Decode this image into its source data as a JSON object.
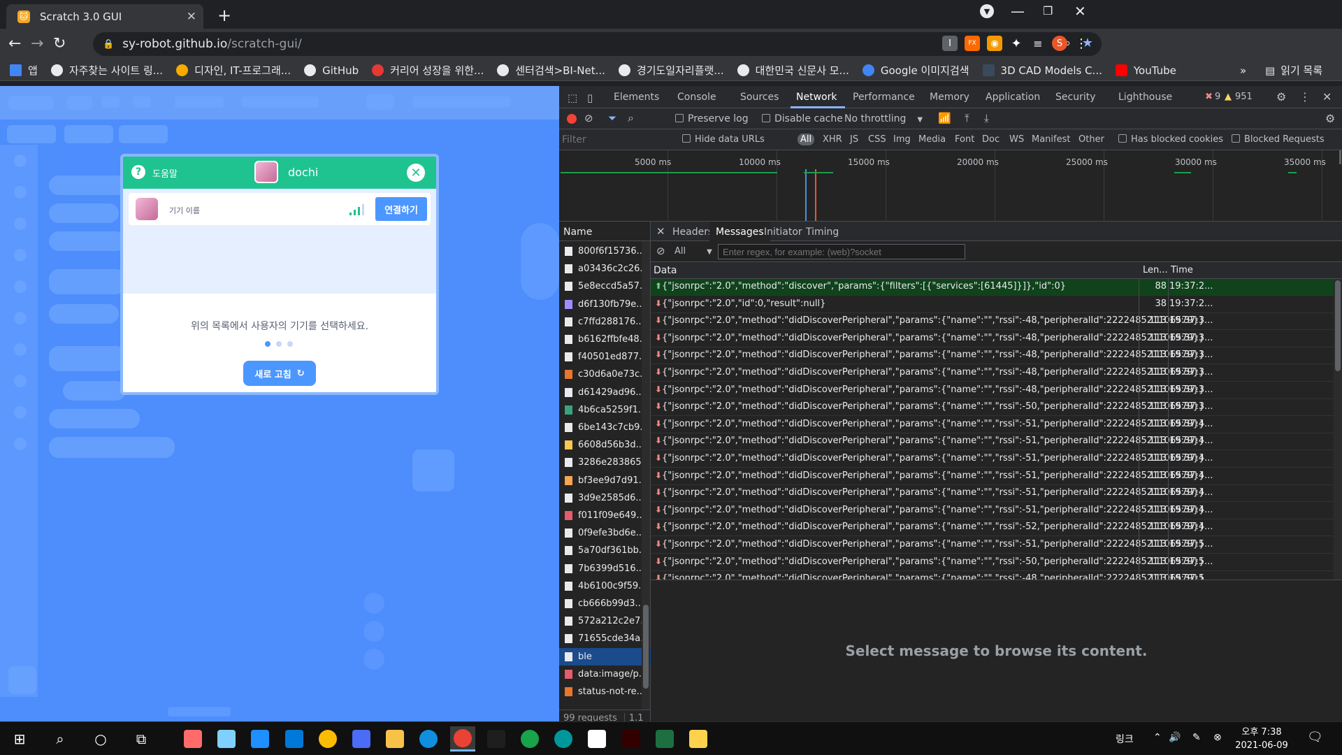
{
  "browser": {
    "tab_title": "Scratch 3.0 GUI",
    "url_host": "sy-robot.github.io",
    "url_path": "/scratch-gui/",
    "profile_initial": "S"
  },
  "bookmarks": [
    {
      "label": "앱",
      "color": "#4285f4"
    },
    {
      "label": "자주찾는 사이트 링...",
      "color": "#e8eaed"
    },
    {
      "label": "디자인, IT-프로그래...",
      "color": "#f9ab00"
    },
    {
      "label": "GitHub",
      "color": "#e8eaed"
    },
    {
      "label": "커리어 성장을 위한...",
      "color": "#e53935"
    },
    {
      "label": "센터검색>BI-Net...",
      "color": "#e8eaed"
    },
    {
      "label": "경기도일자리플랫...",
      "color": "#e8eaed"
    },
    {
      "label": "대한민국 신문사 모...",
      "color": "#e8eaed"
    },
    {
      "label": "Google 이미지검색",
      "color": "#4285f4"
    },
    {
      "label": "3D CAD Models C...",
      "color": "#3a4a5c"
    },
    {
      "label": "YouTube",
      "color": "#ff0000"
    }
  ],
  "bookmarks_more": "»",
  "reading_list": "읽기 목록",
  "modal": {
    "help_label": "도움말",
    "device_title": "dochi",
    "device_name": "기기 이름",
    "connect_label": "연결하기",
    "instruction": "위의 목록에서 사용자의 기기를 선택하세요.",
    "refresh_label": "새로 고침"
  },
  "devtools": {
    "tabs": [
      "Elements",
      "Console",
      "Sources",
      "Network",
      "Performance",
      "Memory",
      "Application",
      "Security",
      "Lighthouse"
    ],
    "active_tab": "Network",
    "error_count": "9",
    "warning_count": "951",
    "preserve_log": "Preserve log",
    "disable_cache": "Disable cache",
    "throttling": "No throttling",
    "filter_placeholder": "Filter",
    "hide_data_urls": "Hide data URLs",
    "type_filters": [
      "All",
      "XHR",
      "JS",
      "CSS",
      "Img",
      "Media",
      "Font",
      "Doc",
      "WS",
      "Manifest",
      "Other"
    ],
    "has_blocked_cookies": "Has blocked cookies",
    "blocked_requests": "Blocked Requests",
    "timeline_labels": [
      "5000 ms",
      "10000 ms",
      "15000 ms",
      "20000 ms",
      "25000 ms",
      "30000 ms",
      "35000 ms"
    ],
    "name_header": "Name",
    "requests": [
      {
        "name": "800f6f15736...",
        "color": "#e8eaed"
      },
      {
        "name": "a03436c2c26...",
        "color": "#e8eaed"
      },
      {
        "name": "5e8eccd5a57...",
        "color": "#e8eaed"
      },
      {
        "name": "d6f130fb79e...",
        "color": "#a08cff"
      },
      {
        "name": "c7ffd288176...",
        "color": "#e8eaed"
      },
      {
        "name": "b6162ffbfe48...",
        "color": "#e8eaed"
      },
      {
        "name": "f40501ed877...",
        "color": "#e8eaed"
      },
      {
        "name": "c30d6a0e73c...",
        "color": "#e8762b"
      },
      {
        "name": "d61429ad96...",
        "color": "#e8eaed"
      },
      {
        "name": "4b6ca5259f1...",
        "color": "#3aa17e"
      },
      {
        "name": "6be143c7cb9...",
        "color": "#e8eaed"
      },
      {
        "name": "6608d56b3d...",
        "color": "#f9c74f"
      },
      {
        "name": "3286e283865...",
        "color": "#e8eaed"
      },
      {
        "name": "bf3ee9d7d91...",
        "color": "#f9a64f"
      },
      {
        "name": "3d9e2585d6...",
        "color": "#e8eaed"
      },
      {
        "name": "f011f09e649...",
        "color": "#e35d6a"
      },
      {
        "name": "0f9efe3bd6e...",
        "color": "#e8eaed"
      },
      {
        "name": "5a70df361bb...",
        "color": "#e8eaed"
      },
      {
        "name": "7b6399d516...",
        "color": "#e8eaed"
      },
      {
        "name": "4b6100c9f59...",
        "color": "#e8eaed"
      },
      {
        "name": "cb666b99d3...",
        "color": "#e8eaed"
      },
      {
        "name": "572a212c2e7...",
        "color": "#e8eaed"
      },
      {
        "name": "71655cde34a...",
        "color": "#e8eaed"
      },
      {
        "name": "ble",
        "color": "#e8eaed"
      },
      {
        "name": "data:image/p...",
        "color": "#e35d6a"
      },
      {
        "name": "status-not-re...",
        "color": "#e8762b"
      }
    ],
    "selected_request": "ble",
    "requests_count": "99 requests",
    "transfer": "1.1",
    "detail_tabs": [
      "Headers",
      "Messages",
      "Initiator",
      "Timing"
    ],
    "detail_active": "Messages",
    "message_filter": "All",
    "regex_placeholder": "Enter regex, for example: (web)?socket",
    "col_data": "Data",
    "col_length": "Len...",
    "col_time": "Time",
    "messages": [
      {
        "dir": "sent",
        "data": "{\"jsonrpc\":\"2.0\",\"method\":\"discover\",\"params\":{\"filters\":[{\"services\":[61445]}]},\"id\":0}",
        "len": "88",
        "time": "19:37:2..."
      },
      {
        "dir": "recv",
        "data": "{\"jsonrpc\":\"2.0\",\"id\":0,\"result\":null}",
        "len": "38",
        "time": "19:37:2..."
      },
      {
        "dir": "recv",
        "data": "{\"jsonrpc\":\"2.0\",\"method\":\"didDiscoverPeripheral\",\"params\":{\"name\":\"\",\"rssi\":-48,\"peripheralId\":222248521106579}}",
        "len": "113",
        "time": "19:37:3..."
      },
      {
        "dir": "recv",
        "data": "{\"jsonrpc\":\"2.0\",\"method\":\"didDiscoverPeripheral\",\"params\":{\"name\":\"\",\"rssi\":-48,\"peripheralId\":222248521106579}}",
        "len": "113",
        "time": "19:37:3..."
      },
      {
        "dir": "recv",
        "data": "{\"jsonrpc\":\"2.0\",\"method\":\"didDiscoverPeripheral\",\"params\":{\"name\":\"\",\"rssi\":-48,\"peripheralId\":222248521106579}}",
        "len": "113",
        "time": "19:37:3..."
      },
      {
        "dir": "recv",
        "data": "{\"jsonrpc\":\"2.0\",\"method\":\"didDiscoverPeripheral\",\"params\":{\"name\":\"\",\"rssi\":-48,\"peripheralId\":222248521106579}}",
        "len": "113",
        "time": "19:37:3..."
      },
      {
        "dir": "recv",
        "data": "{\"jsonrpc\":\"2.0\",\"method\":\"didDiscoverPeripheral\",\"params\":{\"name\":\"\",\"rssi\":-48,\"peripheralId\":222248521106579}}",
        "len": "113",
        "time": "19:37:3..."
      },
      {
        "dir": "recv",
        "data": "{\"jsonrpc\":\"2.0\",\"method\":\"didDiscoverPeripheral\",\"params\":{\"name\":\"\",\"rssi\":-50,\"peripheralId\":222248521106579}}",
        "len": "113",
        "time": "19:37:3..."
      },
      {
        "dir": "recv",
        "data": "{\"jsonrpc\":\"2.0\",\"method\":\"didDiscoverPeripheral\",\"params\":{\"name\":\"\",\"rssi\":-51,\"peripheralId\":222248521106579}}",
        "len": "113",
        "time": "19:37:4..."
      },
      {
        "dir": "recv",
        "data": "{\"jsonrpc\":\"2.0\",\"method\":\"didDiscoverPeripheral\",\"params\":{\"name\":\"\",\"rssi\":-51,\"peripheralId\":222248521106579}}",
        "len": "113",
        "time": "19:37:4..."
      },
      {
        "dir": "recv",
        "data": "{\"jsonrpc\":\"2.0\",\"method\":\"didDiscoverPeripheral\",\"params\":{\"name\":\"\",\"rssi\":-51,\"peripheralId\":222248521106579}}",
        "len": "113",
        "time": "19:37:4..."
      },
      {
        "dir": "recv",
        "data": "{\"jsonrpc\":\"2.0\",\"method\":\"didDiscoverPeripheral\",\"params\":{\"name\":\"\",\"rssi\":-51,\"peripheralId\":222248521106579}}",
        "len": "113",
        "time": "19:37:4..."
      },
      {
        "dir": "recv",
        "data": "{\"jsonrpc\":\"2.0\",\"method\":\"didDiscoverPeripheral\",\"params\":{\"name\":\"\",\"rssi\":-51,\"peripheralId\":222248521106579}}",
        "len": "113",
        "time": "19:37:4..."
      },
      {
        "dir": "recv",
        "data": "{\"jsonrpc\":\"2.0\",\"method\":\"didDiscoverPeripheral\",\"params\":{\"name\":\"\",\"rssi\":-51,\"peripheralId\":222248521106579}}",
        "len": "113",
        "time": "19:37:4..."
      },
      {
        "dir": "recv",
        "data": "{\"jsonrpc\":\"2.0\",\"method\":\"didDiscoverPeripheral\",\"params\":{\"name\":\"\",\"rssi\":-52,\"peripheralId\":222248521106579}}",
        "len": "113",
        "time": "19:37:4..."
      },
      {
        "dir": "recv",
        "data": "{\"jsonrpc\":\"2.0\",\"method\":\"didDiscoverPeripheral\",\"params\":{\"name\":\"\",\"rssi\":-51,\"peripheralId\":222248521106579}}",
        "len": "113",
        "time": "19:37:5..."
      },
      {
        "dir": "recv",
        "data": "{\"jsonrpc\":\"2.0\",\"method\":\"didDiscoverPeripheral\",\"params\":{\"name\":\"\",\"rssi\":-50,\"peripheralId\":222248521106579}}",
        "len": "113",
        "time": "19:37:5..."
      },
      {
        "dir": "recv",
        "data": "{\"jsonrpc\":\"2.0\",\"method\":\"didDiscoverPeripheral\",\"params\":{\"name\":\"\",\"rssi\":-48,\"peripheralId\":222248521106579}}",
        "len": "113",
        "time": "19:37:5..."
      },
      {
        "dir": "recv",
        "data": "{\"jsonrpc\":\"2.0\",\"method\":\"didDiscoverPeripheral\",\"params\":{\"name\":\"\",\"rssi\":-50,\"peripheralId\":222248521106579}}",
        "len": "113",
        "time": "19:37:5..."
      }
    ],
    "empty_detail": "Select message to browse its content."
  },
  "taskbar": {
    "tray_link": "링크",
    "time": "오후 7:38",
    "date": "2021-06-09",
    "apps": [
      {
        "name": "paint",
        "color": "#ff6b6b"
      },
      {
        "name": "app-blue",
        "color": "#7fd0ff"
      },
      {
        "name": "internet-explorer",
        "color": "#1e90ff"
      },
      {
        "name": "app-store",
        "color": "#0078d7"
      },
      {
        "name": "chrome",
        "color": "#fbbc05"
      },
      {
        "name": "calculator",
        "color": "#4a6cf7"
      },
      {
        "name": "file-explorer",
        "color": "#f8c148"
      },
      {
        "name": "edge",
        "color": "#0f8fde"
      },
      {
        "name": "chrome-active",
        "color": "#e94335"
      },
      {
        "name": "terminal",
        "color": "#1e1e1e"
      },
      {
        "name": "refresh-app",
        "color": "#19a34a"
      },
      {
        "name": "arduino",
        "color": "#00979c"
      },
      {
        "name": "settings",
        "color": "#ffffff"
      },
      {
        "name": "illustrator",
        "color": "#330000"
      },
      {
        "name": "excel",
        "color": "#1d6f42"
      },
      {
        "name": "penguin",
        "color": "#ffd24d"
      }
    ]
  }
}
